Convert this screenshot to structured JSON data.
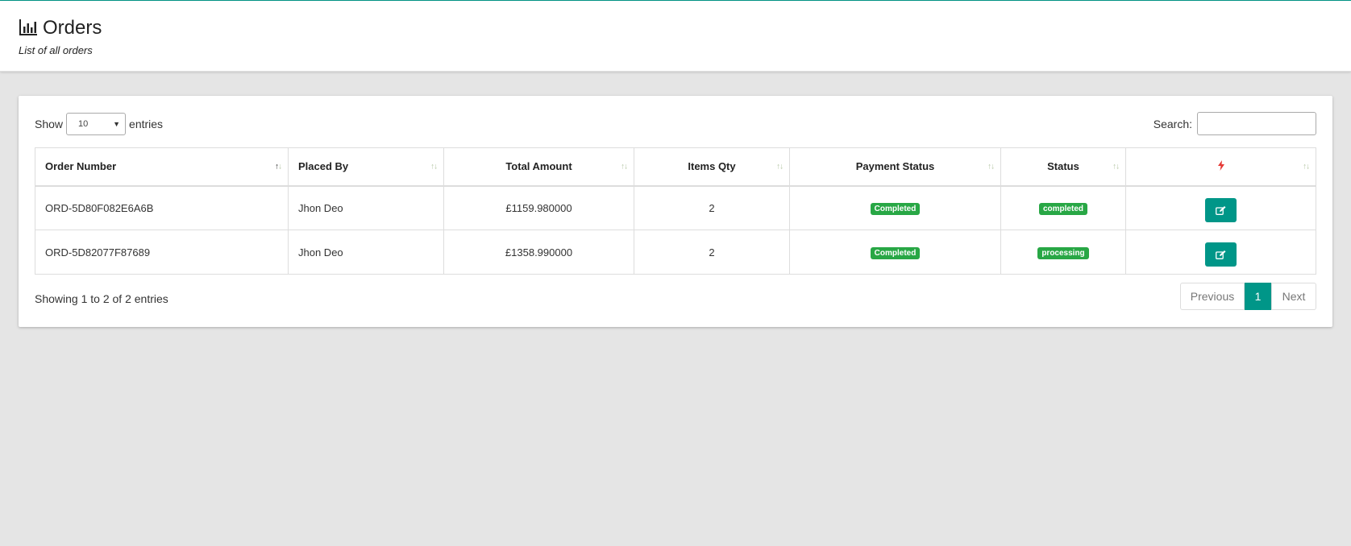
{
  "header": {
    "title": "Orders",
    "subtitle": "List of all orders"
  },
  "controls": {
    "show_label": "Show",
    "entries_value": "10",
    "entries_label": "entries",
    "search_label": "Search:",
    "search_placeholder": ""
  },
  "table": {
    "columns": [
      "Order Number",
      "Placed By",
      "Total Amount",
      "Items Qty",
      "Payment Status",
      "Status"
    ],
    "rows": [
      {
        "order_number": "ORD-5D80F082E6A6B",
        "placed_by": "Jhon Deo",
        "total": "£1159.980000",
        "qty": "2",
        "payment_status": "Completed",
        "status": "completed"
      },
      {
        "order_number": "ORD-5D82077F87689",
        "placed_by": "Jhon Deo",
        "total": "£1358.990000",
        "qty": "2",
        "payment_status": "Completed",
        "status": "processing"
      }
    ]
  },
  "footer": {
    "info": "Showing 1 to 2 of 2 entries",
    "prev": "Previous",
    "page": "1",
    "next": "Next"
  },
  "colors": {
    "accent": "#009688",
    "badge": "#28a745",
    "action_icon": "#e53935"
  },
  "icons": {
    "title": "bar-chart-icon",
    "action_header": "bolt-icon",
    "edit": "edit-icon"
  }
}
